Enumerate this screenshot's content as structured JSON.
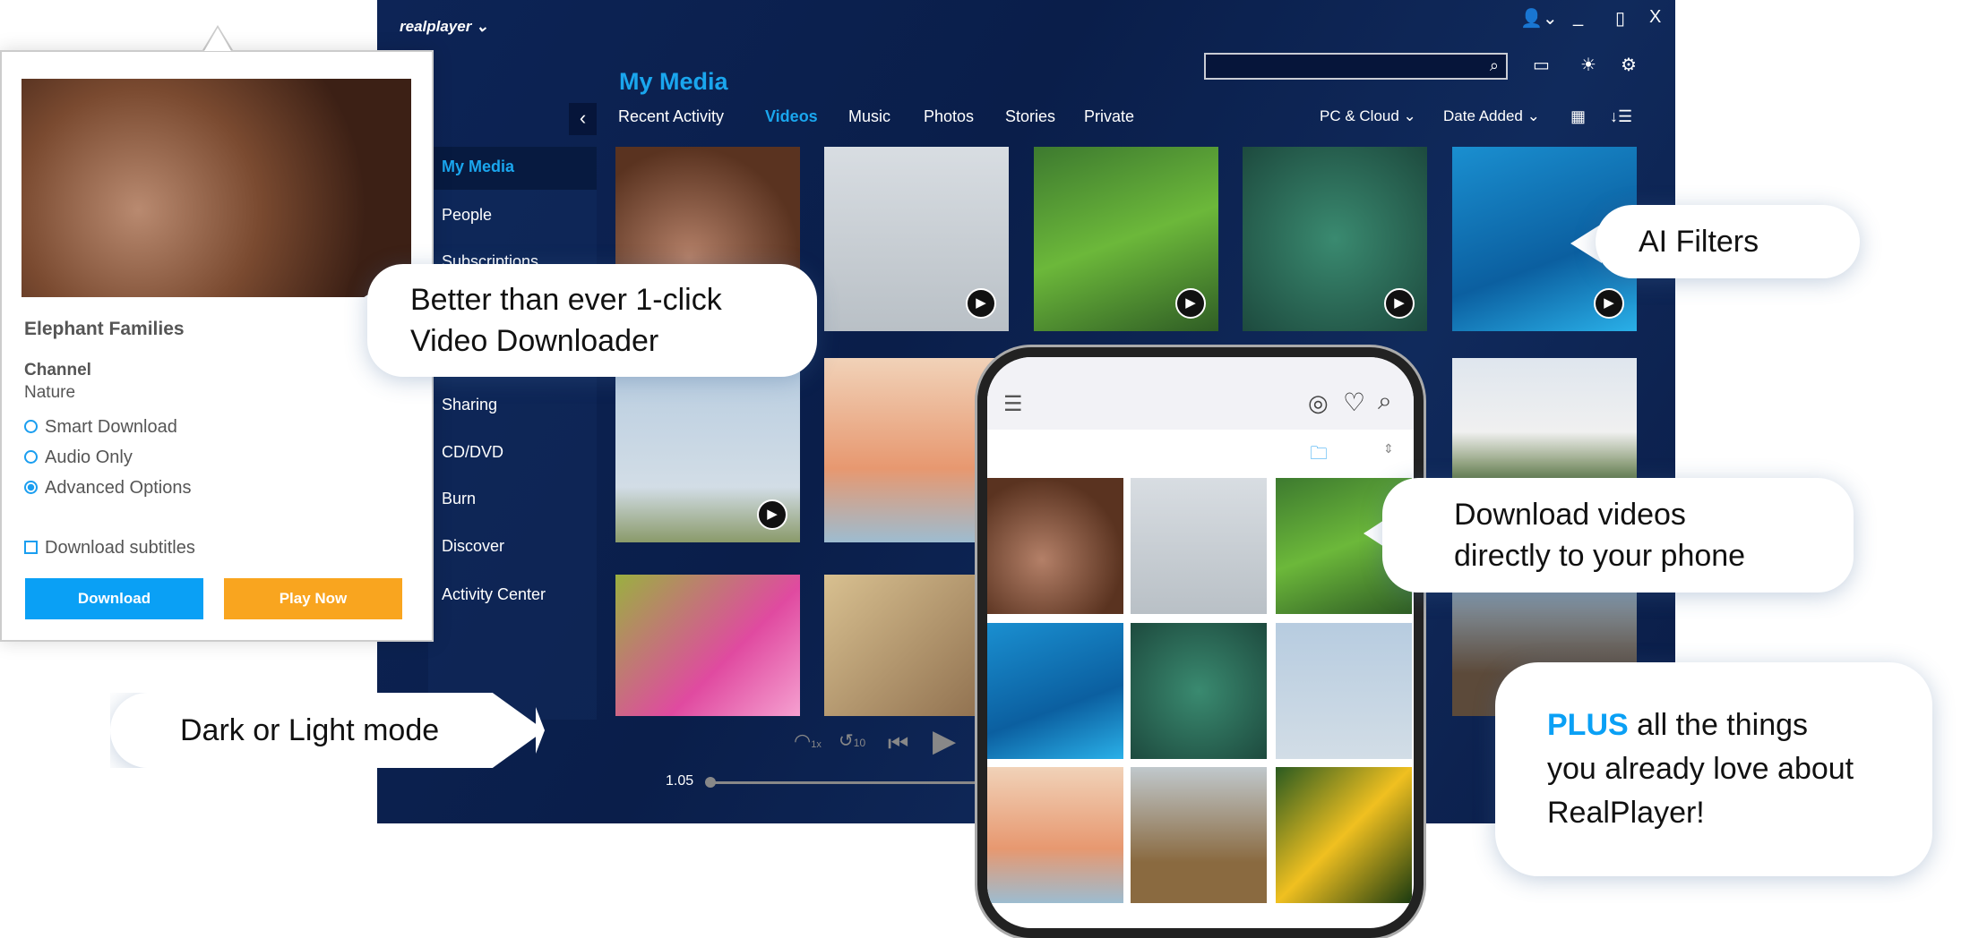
{
  "app": {
    "logo": "realplayer ⌄",
    "window_controls": {
      "user": "👤⌄",
      "minimize": "_",
      "maximize": "▯",
      "close": "X"
    },
    "search": {
      "value": "",
      "placeholder": ""
    },
    "title": "My Media",
    "tabs": [
      {
        "label": "Recent Activity"
      },
      {
        "label": "Videos",
        "active": true
      },
      {
        "label": "Music"
      },
      {
        "label": "Photos"
      },
      {
        "label": "Stories"
      },
      {
        "label": "Private"
      }
    ],
    "filters": {
      "source": "PC & Cloud ⌄",
      "sort": "Date Added ⌄"
    },
    "sidebar": [
      {
        "label": "My Media",
        "active": true
      },
      {
        "label": "People"
      },
      {
        "label": "Subscriptions"
      },
      {
        "label": "Sharing"
      },
      {
        "label": "CD/DVD"
      },
      {
        "label": "Burn"
      },
      {
        "label": "Discover"
      },
      {
        "label": "Activity Center"
      }
    ],
    "player": {
      "time": "1.05",
      "speed_label": "1x",
      "skip_label": "10",
      "progress": 0
    }
  },
  "popup": {
    "title": "Elephant Families",
    "channel_label": "Channel",
    "channel": "Nature",
    "options": [
      {
        "label": "Smart Download",
        "selected": false
      },
      {
        "label": "Audio Only",
        "selected": false
      },
      {
        "label": "Advanced Options",
        "selected": true
      }
    ],
    "subtitles": {
      "label": "Download subtitles",
      "checked": false
    },
    "download": "Download",
    "play_now": "Play Now"
  },
  "callouts": {
    "downloader": [
      "Better than ever 1-click",
      "Video Downloader"
    ],
    "ai": "AI Filters",
    "phone": [
      "Download videos",
      "directly to your phone"
    ],
    "mode": "Dark or Light mode",
    "plus": {
      "accent": "PLUS",
      "line1": " all the things",
      "line2": "you already love about",
      "line3": "RealPlayer!"
    }
  },
  "colors": {
    "accent": "#1aa6ee",
    "download": "#0aa0f5",
    "play_now": "#f9a51f",
    "app_bg": "#0b2050"
  }
}
